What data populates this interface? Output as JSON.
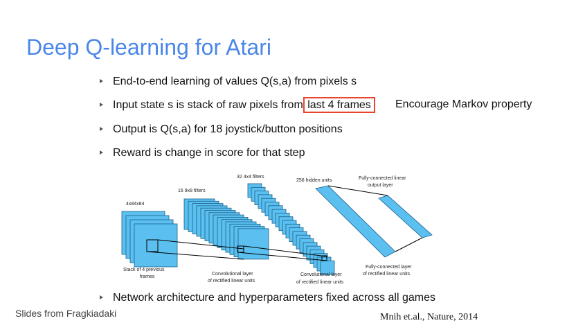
{
  "slide": {
    "title": "Deep Q-learning for Atari",
    "bullets": [
      {
        "before": "End-to-end learning of values Q(s,a) from pixels s",
        "highlight": "",
        "after": ""
      },
      {
        "before": "Input state s is stack of raw pixels from ",
        "highlight": "last 4 frames",
        "after": ""
      },
      {
        "before": "Output is Q(s,a) for 18 joystick/button positions",
        "highlight": "",
        "after": ""
      },
      {
        "before": "Reward is change in score for that step",
        "highlight": "",
        "after": ""
      }
    ],
    "side_note": "Encourage Markov property",
    "bottom_bullet": "Network architecture and hyperparameters fixed across all games",
    "credit": "Slides from Fragkiadaki",
    "citation": "Mnih et.al., Nature, 2014",
    "highlight_color": "#e8452c",
    "title_color": "#4a86e8"
  },
  "diagram": {
    "top_labels": {
      "input": "4x84x84",
      "conv1": "16 8x8 filters",
      "conv2": "32 4x4 filters",
      "hidden": "256 hidden units",
      "output_line1": "Fully-connected linear",
      "output_line2": "output layer"
    },
    "bottom_labels": {
      "input_line1": "Stack of 4 previous",
      "input_line2": "frames",
      "conv1_line1": "Convolutional layer",
      "conv1_line2": "of rectified linear units",
      "conv2_line1": "Convolutional layer",
      "conv2_line2": "of rectified linear units",
      "fc_line1": "Fully-connected layer",
      "fc_line2": "of rectified linear units"
    },
    "input_frames": 4,
    "conv1_filters": 16,
    "conv2_filters": 32,
    "fill_color": "#5bc0f0",
    "stroke_color": "#1a5f8a"
  }
}
